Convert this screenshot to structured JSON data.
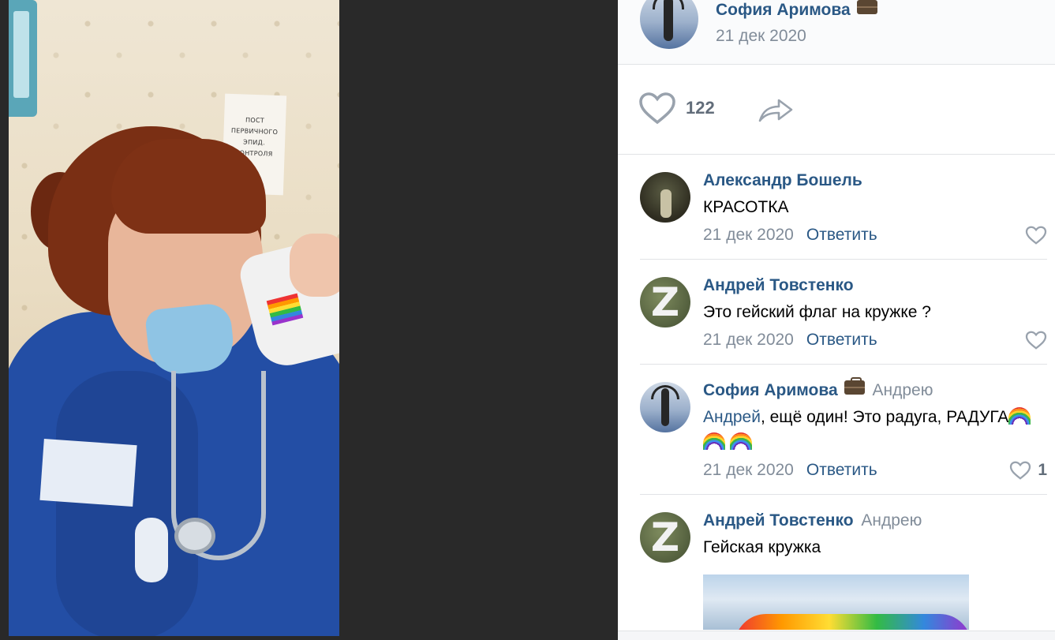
{
  "photo": {
    "sign_text": "ПОСТ ПЕРВИЧНОГО ЭПИД. КОНТРОЛЯ"
  },
  "post": {
    "author": "София Аримова",
    "date": "21 дек 2020",
    "likes": "122"
  },
  "comments": [
    {
      "author": "Александр Бошель",
      "reply_to": "",
      "text": "КРАСОТКА",
      "date": "21 дек 2020",
      "reply_label": "Ответить",
      "likes": ""
    },
    {
      "author": "Андрей Товстенко",
      "reply_to": "",
      "text": "Это гейский флаг на кружке ?",
      "date": "21 дек 2020",
      "reply_label": "Ответить",
      "likes": ""
    },
    {
      "author": "София Аримова",
      "reply_to": "Андрею",
      "mention": "Андрей",
      "text": ", ещё один! Это радуга, РАДУГА",
      "emoji": [
        "rainbow-emoji",
        "rainbow-emoji",
        "rainbow-emoji"
      ],
      "date": "21 дек 2020",
      "reply_label": "Ответить",
      "likes": "1"
    },
    {
      "author": "Андрей Товстенко",
      "reply_to": "Андрею",
      "text": "Гейская кружка",
      "date": "",
      "reply_label": "",
      "likes": ""
    }
  ],
  "icons": {
    "like": "heart-icon",
    "share": "share-arrow-icon",
    "badge": "briefcase-icon"
  },
  "colors": {
    "link": "#2a5885",
    "secondary": "#818c99",
    "background_dark": "#292929"
  }
}
